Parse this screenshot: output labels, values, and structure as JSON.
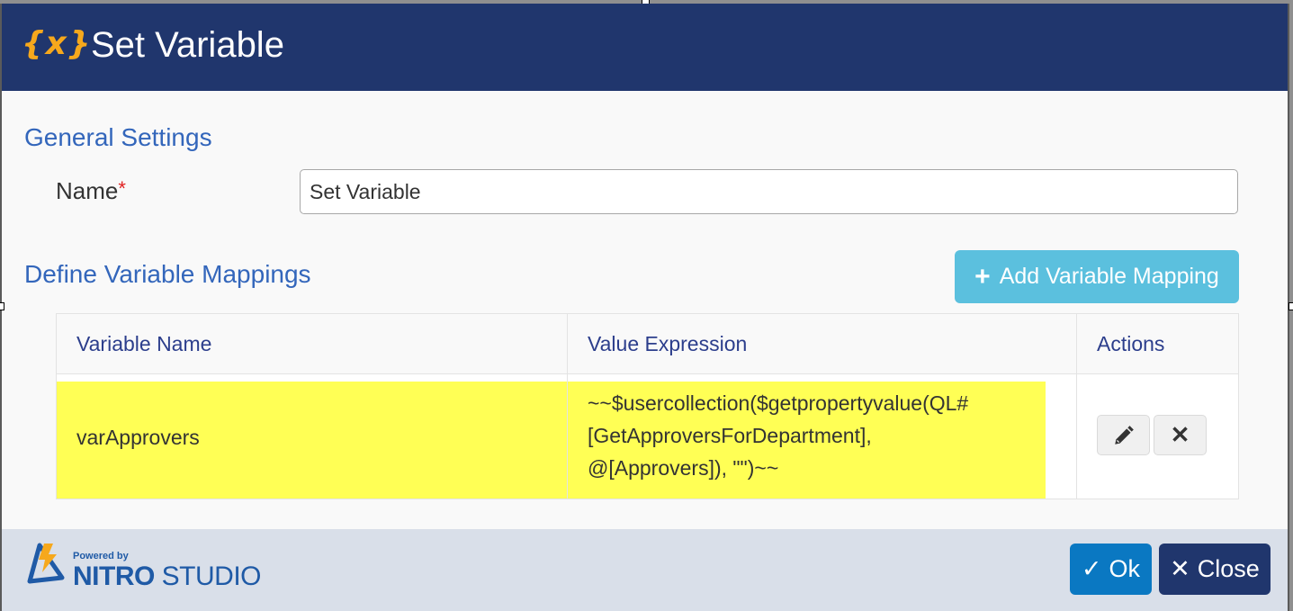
{
  "dialog": {
    "title": "Set Variable",
    "title_icon": "{x}"
  },
  "general": {
    "section_title": "General Settings",
    "name_label": "Name",
    "required_marker": "*",
    "name_value": "Set Variable"
  },
  "mappings": {
    "section_title": "Define Variable Mappings",
    "add_button_icon": "+",
    "add_button_label": "Add Variable Mapping",
    "columns": [
      "Variable Name",
      "Value Expression",
      "Actions"
    ],
    "rows": [
      {
        "variable_name": "varApprovers",
        "value_expression_lines": [
          "~~$usercollection($getpropertyvalue(QL#",
          "[GetApproversForDepartment],",
          "@[Approvers]), \"\")~~"
        ],
        "edit_icon": "✏",
        "delete_icon": "✕"
      }
    ]
  },
  "footer": {
    "powered_by": "Powered by",
    "brand_bold": "NITRO",
    "brand_light": "STUDIO",
    "ok_icon": "✓",
    "ok_label": "Ok",
    "close_icon": "✕",
    "close_label": "Close"
  },
  "colors": {
    "titlebar": "#20366d",
    "accent_icon": "#f6a81c",
    "section_title": "#3366bb",
    "add_button": "#5bc0de",
    "highlight": "#ffff55",
    "ok_button": "#0a78c2",
    "close_button": "#20366d",
    "footer": "#d9dfe9"
  }
}
